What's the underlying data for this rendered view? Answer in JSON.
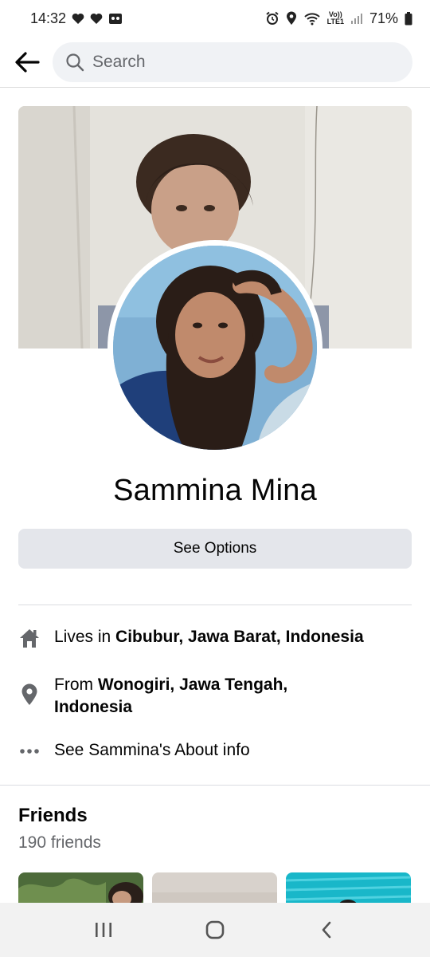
{
  "status_bar": {
    "time": "14:32",
    "battery": "71%",
    "network": "LTE1",
    "volte": "Vo))"
  },
  "search": {
    "placeholder": "Search"
  },
  "profile": {
    "name": "Sammina Mina",
    "options_label": "See Options"
  },
  "about": {
    "lives_prefix": "Lives in ",
    "lives_place": "Cibubur, Jawa Barat, Indonesia",
    "from_prefix": "From ",
    "from_place": "Wonogiri, Jawa Tengah, Indonesia",
    "about_link": "See Sammina's About info"
  },
  "friends": {
    "title": "Friends",
    "count": "190 friends"
  },
  "colors": {
    "background": "#ffffff",
    "button_bg": "#e4e6eb",
    "search_bg": "#f0f2f5",
    "secondary_text": "#65676b",
    "icon_gray": "#65676b"
  },
  "icons": {
    "back": "arrow-left-icon",
    "search": "search-icon",
    "home": "home-icon",
    "location": "location-pin-icon",
    "more": "more-dots-icon",
    "nav_recents": "recents-icon",
    "nav_home": "home-circle-icon",
    "nav_back": "chevron-left-icon"
  }
}
